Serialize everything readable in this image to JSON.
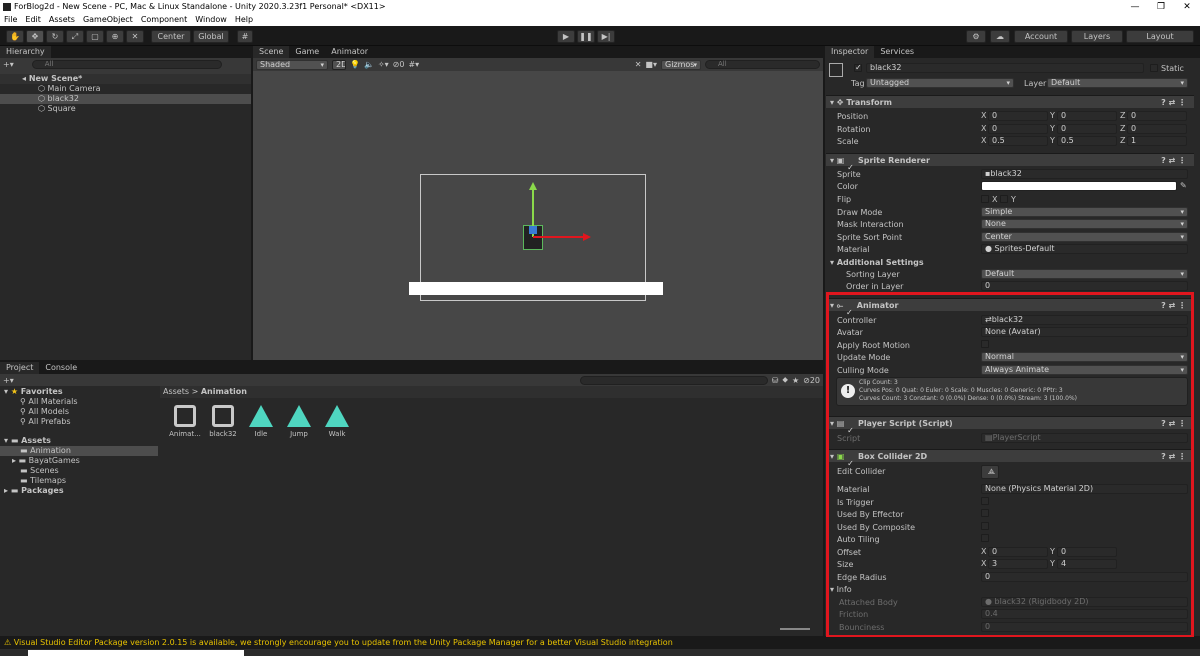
{
  "window": {
    "title": "ForBlog2d - New Scene - PC, Mac & Linux Standalone - Unity 2020.3.23f1 Personal* <DX11>"
  },
  "menu": [
    "File",
    "Edit",
    "Assets",
    "GameObject",
    "Component",
    "Window",
    "Help"
  ],
  "toolbar": {
    "center": "Center",
    "global": "Global",
    "account": "Account",
    "layers": "Layers",
    "layout": "Layout"
  },
  "hierarchy": {
    "tab": "Hierarchy",
    "search_placeholder": "All",
    "scene": "New Scene*",
    "items": [
      "Main Camera",
      "black32",
      "Square"
    ]
  },
  "scene_view": {
    "tabs": [
      "Scene",
      "Game",
      "Animator"
    ],
    "shading": "Shaded",
    "mode2d": "2D",
    "hidden_count": "0",
    "gizmos": "Gizmos",
    "search_placeholder": "All"
  },
  "project": {
    "tabs": [
      "Project",
      "Console"
    ],
    "favorites": "Favorites",
    "fav_items": [
      "All Materials",
      "All Models",
      "All Prefabs"
    ],
    "assets": "Assets",
    "asset_folders": [
      "Animation",
      "BayatGames",
      "Scenes",
      "Tilemaps"
    ],
    "packages": "Packages",
    "breadcrumb_root": "Assets",
    "breadcrumb_leaf": "Animation",
    "hidden_count": "20",
    "files": [
      "Animat...",
      "black32",
      "Idle",
      "Jump",
      "Walk"
    ]
  },
  "inspector": {
    "tabs": [
      "Inspector",
      "Services"
    ],
    "object_name": "black32",
    "static": "Static",
    "tag_label": "Tag",
    "tag": "Untagged",
    "layer_label": "Layer",
    "layer": "Default",
    "transform": {
      "title": "Transform",
      "position": "Position",
      "rotation": "Rotation",
      "scale": "Scale",
      "pos": [
        "0",
        "0",
        "0"
      ],
      "rot": [
        "0",
        "0",
        "0"
      ],
      "scl": [
        "0.5",
        "0.5",
        "1"
      ]
    },
    "sprite_renderer": {
      "title": "Sprite Renderer",
      "sprite_label": "Sprite",
      "sprite": "black32",
      "color_label": "Color",
      "flip_label": "Flip",
      "flip_x": "X",
      "flip_y": "Y",
      "draw_mode_label": "Draw Mode",
      "draw_mode": "Simple",
      "mask_label": "Mask Interaction",
      "mask": "None",
      "sort_point_label": "Sprite Sort Point",
      "sort_point": "Center",
      "material_label": "Material",
      "material": "Sprites-Default",
      "additional": "Additional Settings",
      "sorting_layer_label": "Sorting Layer",
      "sorting_layer": "Default",
      "order_label": "Order in Layer",
      "order": "0"
    },
    "animator": {
      "title": "Animator",
      "controller_label": "Controller",
      "controller": "black32",
      "avatar_label": "Avatar",
      "avatar": "None (Avatar)",
      "root_motion_label": "Apply Root Motion",
      "update_label": "Update Mode",
      "update": "Normal",
      "culling_label": "Culling Mode",
      "culling": "Always Animate",
      "info1": "Clip Count: 3",
      "info2": "Curves Pos: 0 Quat: 0 Euler: 0 Scale: 0 Muscles: 0 Generic: 0 PPtr: 3",
      "info3": "Curves Count: 3 Constant: 0 (0.0%) Dense: 0 (0.0%) Stream: 3 (100.0%)"
    },
    "player_script": {
      "title": "Player Script (Script)",
      "script_label": "Script",
      "script": "PlayerScript"
    },
    "box_collider": {
      "title": "Box Collider 2D",
      "edit_label": "Edit Collider",
      "material_label": "Material",
      "material": "None (Physics Material 2D)",
      "trigger_label": "Is Trigger",
      "effector_label": "Used By Effector",
      "composite_label": "Used By Composite",
      "tiling_label": "Auto Tiling",
      "offset_label": "Offset",
      "offset": [
        "0",
        "0"
      ],
      "size_label": "Size",
      "size": [
        "3",
        "4"
      ],
      "radius_label": "Edge Radius",
      "radius": "0",
      "info_label": "Info",
      "body_label": "Attached Body",
      "body": "black32 (Rigidbody 2D)",
      "friction_label": "Friction",
      "friction": "0.4",
      "bounciness_label": "Bounciness",
      "bounciness": "0"
    }
  },
  "status": {
    "message": "Visual Studio Editor Package version 2.0.15 is available, we strongly encourage you to update from the Unity Package Manager for a better Visual Studio integration"
  },
  "axis": {
    "x": "X",
    "y": "Y",
    "z": "Z"
  },
  "colors": {
    "highlight": "#e0161e",
    "selection": "#2c5d87"
  }
}
